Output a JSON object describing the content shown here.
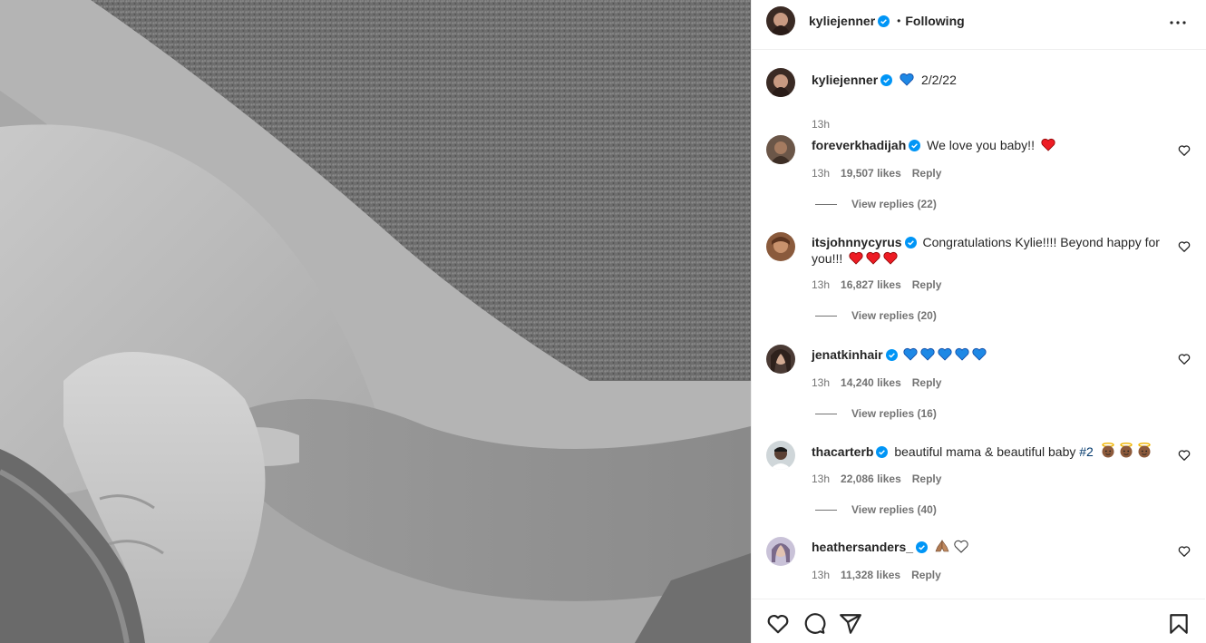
{
  "post": {
    "author": "kyliejenner",
    "follow_status": "Following",
    "more_icon": "more-horizontal-icon"
  },
  "caption": {
    "author": "kyliejenner",
    "text": "2/2/22",
    "time": "13h"
  },
  "comments": [
    {
      "user": "foreverkhadijah",
      "text": "We love you baby!!",
      "time": "13h",
      "likes": "19,507 likes",
      "reply": "Reply",
      "view_replies": "View replies (22)"
    },
    {
      "user": "itsjohnnycyrus",
      "text": "Congratulations Kylie!!!! Beyond happy for you!!!",
      "time": "13h",
      "likes": "16,827 likes",
      "reply": "Reply",
      "view_replies": "View replies (20)"
    },
    {
      "user": "jenatkinhair",
      "text": "",
      "time": "13h",
      "likes": "14,240 likes",
      "reply": "Reply",
      "view_replies": "View replies (16)"
    },
    {
      "user": "thacarterb",
      "text": "beautiful mama & beautiful baby",
      "hashtag": "#2",
      "time": "13h",
      "likes": "22,086 likes",
      "reply": "Reply",
      "view_replies": "View replies (40)"
    },
    {
      "user": "heathersanders_",
      "text": "",
      "time": "13h",
      "likes": "11,328 likes",
      "reply": "Reply"
    }
  ],
  "colors": {
    "verified_blue": "#0095f6",
    "heart_red": "#ed1c24",
    "heart_blue": "#1e88e5",
    "hashtag": "#00376b",
    "muted": "#737373"
  }
}
